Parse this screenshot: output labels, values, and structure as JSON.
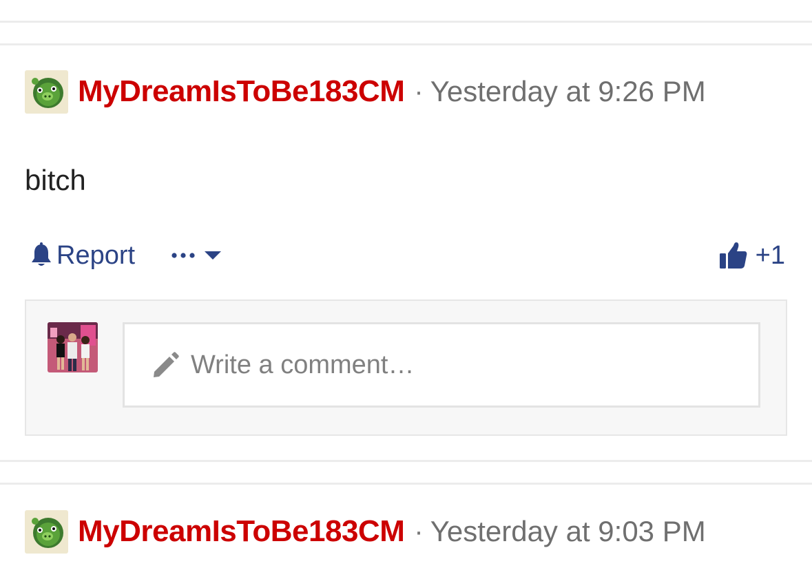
{
  "posts": [
    {
      "username": "MyDreamIsToBe183CM",
      "separator": "·",
      "timestamp": "Yesterday at 9:26 PM",
      "body": "bitch",
      "avatar_icon": "pig-avatar-icon"
    },
    {
      "username": "MyDreamIsToBe183CM",
      "separator": "·",
      "timestamp": "Yesterday at 9:03 PM",
      "avatar_icon": "pig-avatar-icon"
    }
  ],
  "actions": {
    "report_label": "Report",
    "report_icon": "bell-icon",
    "more_icon": "ellipsis-icon",
    "dropdown_icon": "caret-down-icon",
    "like_icon": "thumbs-up-icon",
    "like_count": "+1"
  },
  "comment": {
    "placeholder": "Write a comment…",
    "icon": "pencil-icon"
  },
  "colors": {
    "username": "#cc0000",
    "link": "#2b4385",
    "timestamp": "#6f6f6f",
    "separator_line": "#ececec",
    "comment_box_bg": "#f7f7f7"
  }
}
